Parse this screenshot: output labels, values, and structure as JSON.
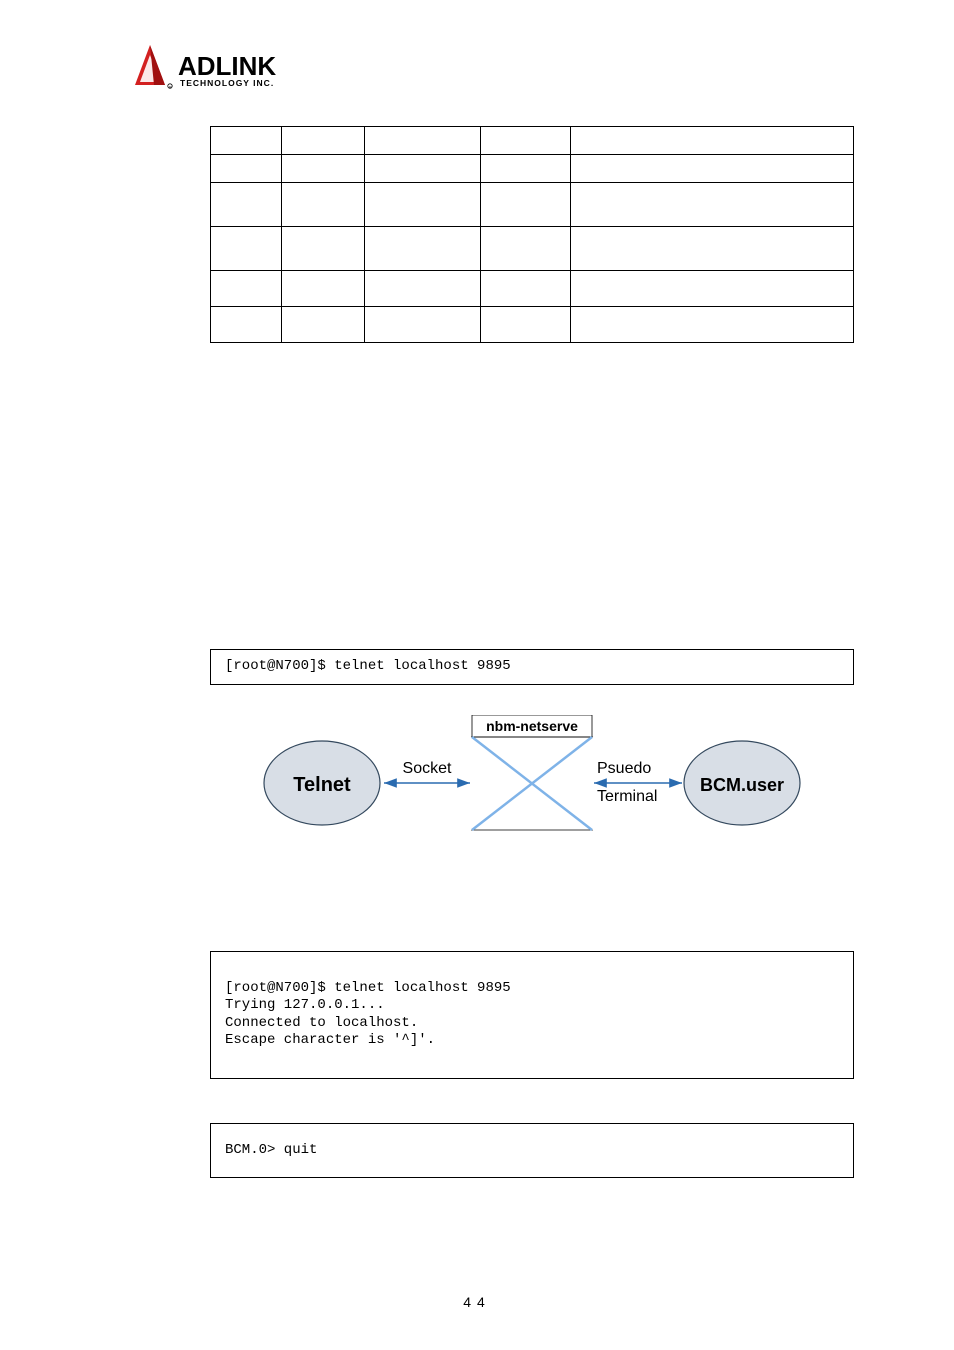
{
  "logo": {
    "name": "ADLINK",
    "tagline": "TECHNOLOGY INC."
  },
  "table": {
    "rows": [
      [
        "",
        "",
        "",
        "",
        ""
      ],
      [
        "",
        "",
        "",
        "",
        ""
      ],
      [
        "",
        "",
        "",
        "",
        ""
      ],
      [
        "",
        "",
        "",
        "",
        ""
      ],
      [
        "",
        "",
        "",
        "",
        ""
      ],
      [
        "",
        "",
        "",
        "",
        ""
      ]
    ]
  },
  "code1": "[root@N700]$ telnet localhost 9895",
  "diagram": {
    "title": "nbm-netserve",
    "left_node": "Telnet",
    "right_node": "BCM.user",
    "left_label": "Socket",
    "right_label_top": "Psuedo",
    "right_label_bottom": "Terminal"
  },
  "code2_line1": "[root@N700]$ telnet localhost 9895",
  "code2_line2": "Trying 127.0.0.1...",
  "code2_line3": "Connected to localhost.",
  "code2_line4": "Escape character is '^]'.",
  "code3": "BCM.0> quit",
  "page_number": "44"
}
